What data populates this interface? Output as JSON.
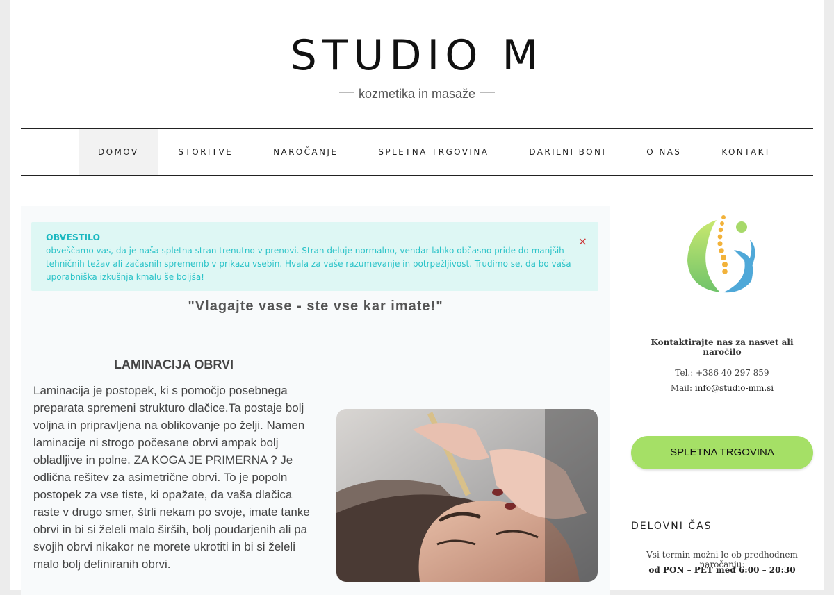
{
  "header": {
    "site_title": "STUDIO M",
    "tagline": "kozmetika in masaže"
  },
  "nav": {
    "items": [
      {
        "label": "DOMOV",
        "active": true
      },
      {
        "label": "STORITVE",
        "active": false
      },
      {
        "label": "NAROČANJE",
        "active": false
      },
      {
        "label": "SPLETNA TRGOVINA",
        "active": false
      },
      {
        "label": "DARILNI BONI",
        "active": false
      },
      {
        "label": "O NAS",
        "active": false
      },
      {
        "label": "KONTAKT",
        "active": false
      }
    ]
  },
  "alert": {
    "title": "OBVESTILO",
    "text": "obveščamo vas, da je naša spletna stran trenutno v prenovi. Stran deluje normalno, vendar lahko občasno pride do manjših tehničnih težav ali začasnih sprememb v prikazu vsebin. Hvala za vaše razumevanje in potrpežljivost. Trudimo se, da bo vaša uporabniška izkušnja kmalu še boljša!",
    "close": "×"
  },
  "main": {
    "quote": "\"Vlagajte vase - ste vse kar imate!\"",
    "section_title": "LAMINACIJA OBRVI",
    "section_text": "Laminacija je postopek, ki s pomočjo posebnega preparata spremeni strukturo dlačice.Ta postaje bolj voljna in pripravljena na oblikovanje po želji. Namen laminacije ni strogo počesane obrvi ampak bolj obladljive in polne. ZA KOGA JE PRIMERNA ? Je odlična rešitev za asimetrične obrvi. To je popoln postopek za vse tiste, ki opažate, da vaša dlačica raste v drugo smer, štrli nekam po svoje, imate tanke obrvi in bi si želeli malo širših, bolj poudarjenih ali pa svojih obrvi nikakor ne morete ukrotiti in bi si želeli malo bolj definiranih obrvi."
  },
  "sidebar": {
    "contact_head": "Kontaktirajte nas za nasvet ali naročilo",
    "phone": "Tel.: +386 40 297 859",
    "mail_label": "Mail: ",
    "mail": "info@studio-mm.si",
    "shop_button": "SPLETNA TRGOVINA",
    "hours_title": "DELOVNI ČAS",
    "hours_note": "Vsi termin možni le ob predhodnem naročanju:",
    "hours_value": "od PON – PET med  6:00 – 20:30"
  },
  "colors": {
    "alert_bg": "#def7f4",
    "alert_text": "#2bc3c8",
    "button_green": "#a5e066"
  }
}
